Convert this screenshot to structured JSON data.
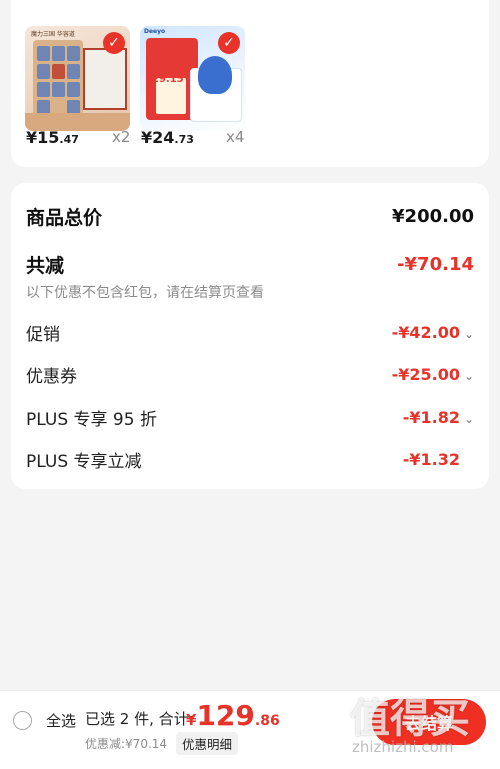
{
  "products": [
    {
      "yen": "¥",
      "price_int": "15",
      "price_dec": ".47",
      "qty": "x2",
      "thumb_label": "魔力三国 华容道"
    },
    {
      "yen": "¥",
      "price_int": "24",
      "price_dec": ".73",
      "qty": "x4",
      "thumb_brand": "Deeyo",
      "thumb_price": "29.15"
    }
  ],
  "summary": {
    "goods_total_label": "商品总价",
    "goods_total_value": "¥200.00",
    "reduction_label": "共减",
    "reduction_value": "-¥70.14",
    "note": "以下优惠不包含红包，请在结算页查看",
    "items": [
      {
        "label": "促销",
        "value": "-¥42.00",
        "chevron": "⌄"
      },
      {
        "label": "优惠券",
        "value": "-¥25.00",
        "chevron": "⌄"
      },
      {
        "label": "PLUS 专享 95 折",
        "value": "-¥1.82",
        "chevron": "⌄"
      },
      {
        "label": "PLUS 专享立减",
        "value": "-¥1.32",
        "chevron": ""
      }
    ]
  },
  "bottom_bar": {
    "select_all": "全选",
    "selected_info": "已选 2 件, 合计:",
    "total_yen": "¥",
    "total_int": "129",
    "total_dec": ".86",
    "discount_text": "优惠减:¥70.14",
    "detail_button": "优惠明细",
    "checkout_button": "去结算"
  },
  "watermark": {
    "text": "值得买",
    "url": "zhizhizhi.com"
  },
  "colors": {
    "accent": "#e8332a",
    "background": "#f4f4f4"
  }
}
